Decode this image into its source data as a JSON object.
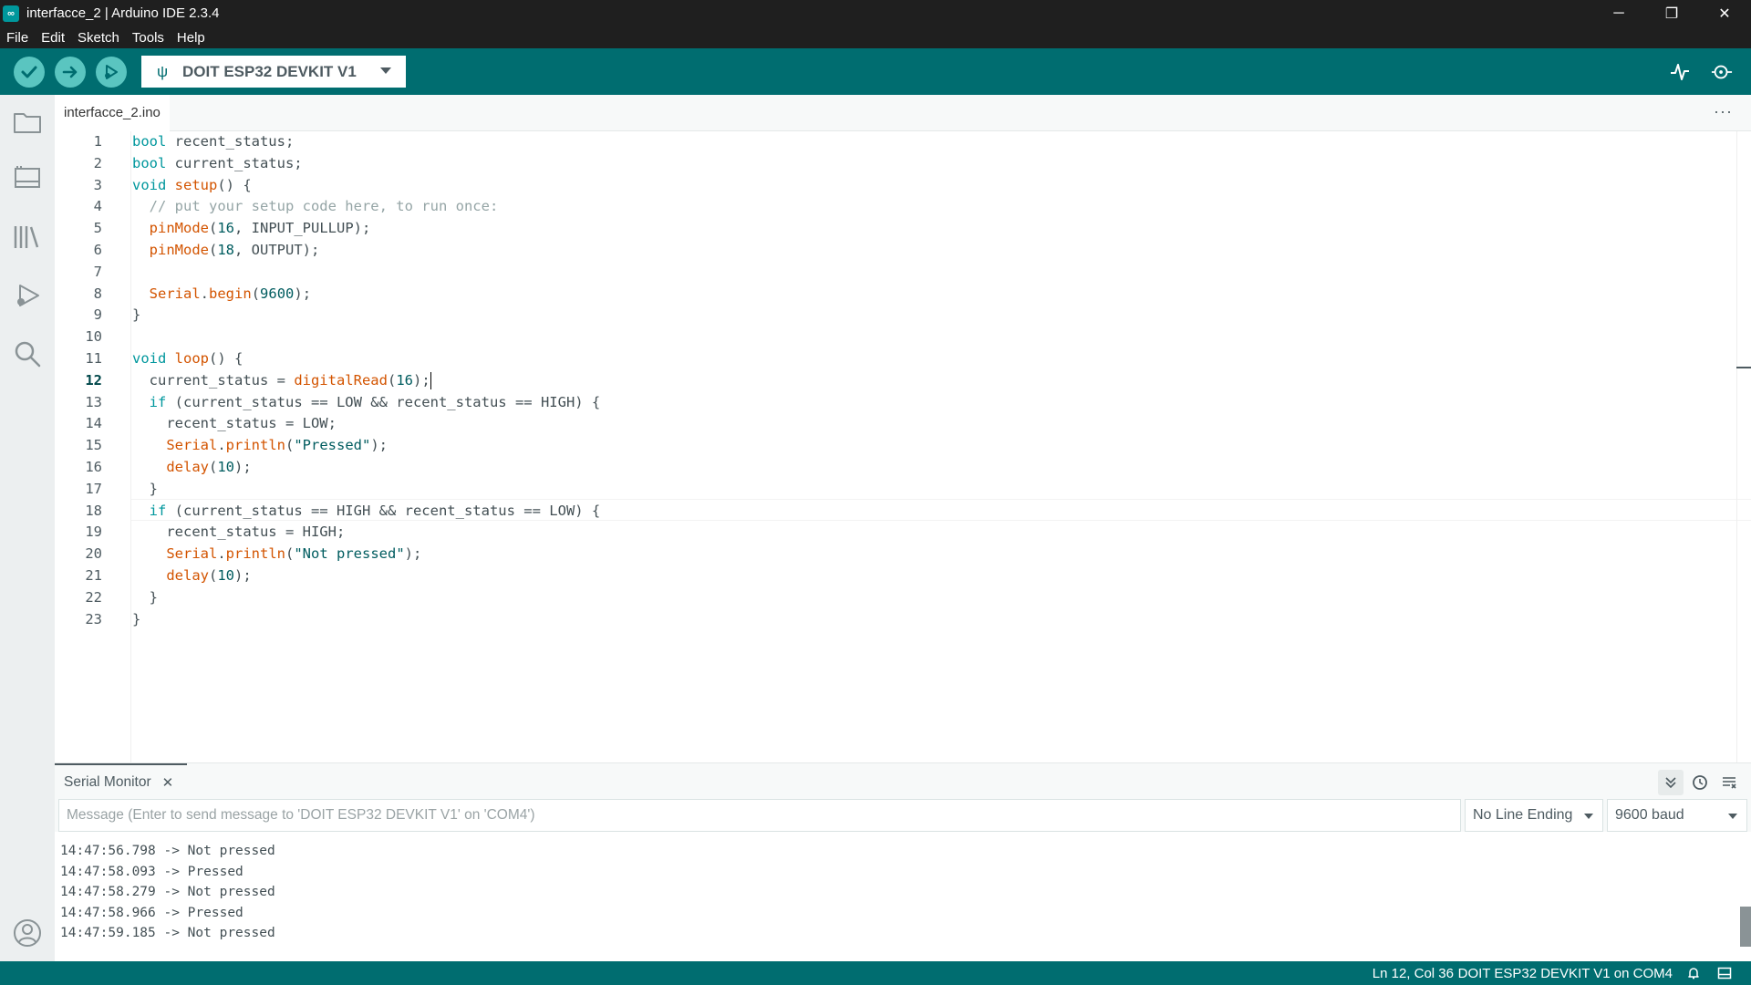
{
  "window": {
    "title": "interfacce_2 | Arduino IDE 2.3.4",
    "minimize": "─",
    "restore": "❐",
    "close": "✕"
  },
  "menu": [
    "File",
    "Edit",
    "Sketch",
    "Tools",
    "Help"
  ],
  "toolbar": {
    "board": "DOIT ESP32 DEVKIT V1",
    "verify_icon": "check-icon",
    "upload_icon": "arrow-right-icon",
    "debug_icon": "debug-icon"
  },
  "tabs": {
    "active": "interfacce_2.ino",
    "more": "···"
  },
  "editor": {
    "line_numbers": [
      "1",
      "2",
      "3",
      "4",
      "5",
      "6",
      "7",
      "8",
      "9",
      "10",
      "11",
      "12",
      "13",
      "14",
      "15",
      "16",
      "17",
      "18",
      "19",
      "20",
      "21",
      "22",
      "23"
    ],
    "active_line": 12
  },
  "serial_monitor": {
    "title": "Serial Monitor",
    "close": "✕",
    "message_placeholder": "Message (Enter to send message to 'DOIT ESP32 DEVKIT V1' on 'COM4')",
    "line_ending": "No Line Ending",
    "baud": "9600 baud",
    "output": [
      "14:47:56.798 -> Not pressed",
      "14:47:58.093 -> Pressed",
      "14:47:58.279 -> Not pressed",
      "14:47:58.966 -> Pressed",
      "14:47:59.185 -> Not pressed"
    ]
  },
  "status": {
    "position": "Ln 12, Col 36",
    "board_port": "DOIT ESP32 DEVKIT V1 on COM4"
  },
  "colors": {
    "accent": "#006d70",
    "button": "#5ac5c0",
    "keyword": "#00979d",
    "function": "#d35400",
    "comment": "#95a5a6"
  }
}
